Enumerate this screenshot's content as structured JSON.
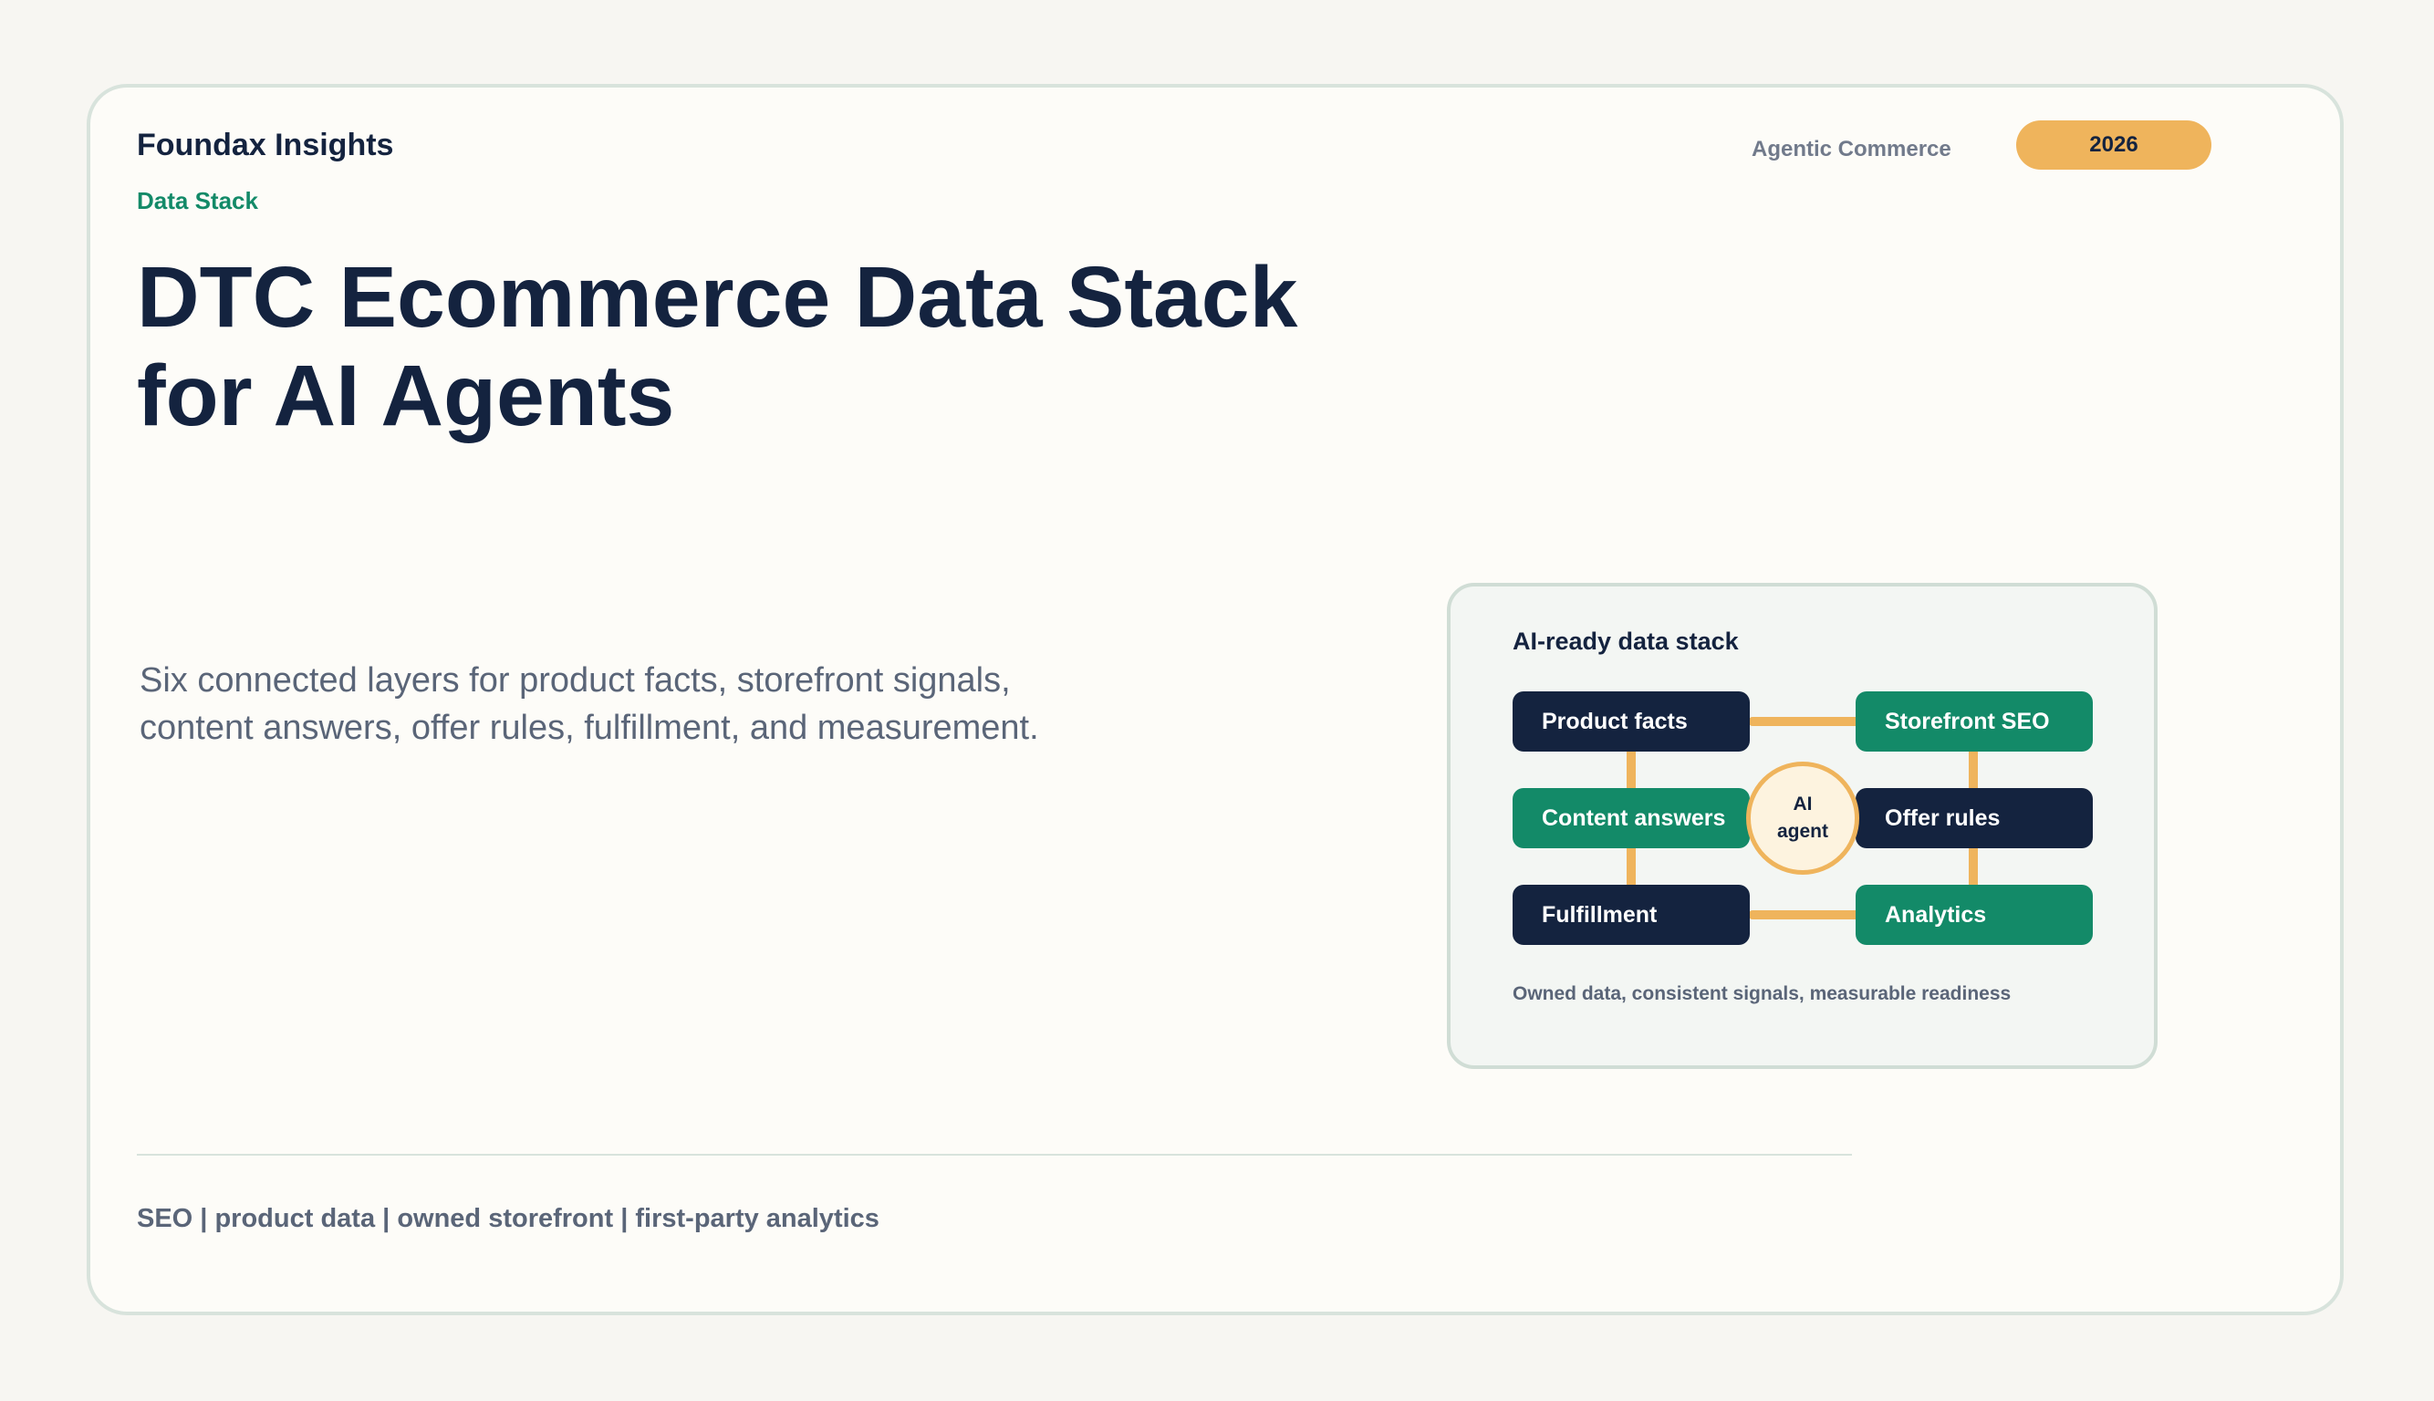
{
  "header": {
    "brand": "Foundax Insights",
    "kicker": "Data Stack",
    "tag_label": "Agentic Commerce",
    "year": "2026"
  },
  "hero": {
    "title_lines": [
      "DTC Ecommerce Data Stack",
      "for AI Agents"
    ],
    "subtitle_lines": [
      "Six connected layers for product facts, storefront signals,",
      "content answers, offer rules, fulfillment, and measurement."
    ]
  },
  "diagram": {
    "title": "AI-ready data stack",
    "nodes": [
      {
        "label": "Product facts"
      },
      {
        "label": "Storefront SEO"
      },
      {
        "label": "Content answers"
      },
      {
        "label": "Offer rules"
      },
      {
        "label": "Fulfillment"
      },
      {
        "label": "Analytics"
      }
    ],
    "hub_lines": [
      "AI",
      "agent"
    ],
    "caption": "Owned data, consistent signals, measurable readiness"
  },
  "footer": {
    "text": "SEO | product data | owned storefront | first-party analytics"
  },
  "colors": {
    "navy": "#14233f",
    "green": "#138a68",
    "amber": "#efb45c",
    "background": "#f7f6f2",
    "card": "#fdfcf8"
  }
}
